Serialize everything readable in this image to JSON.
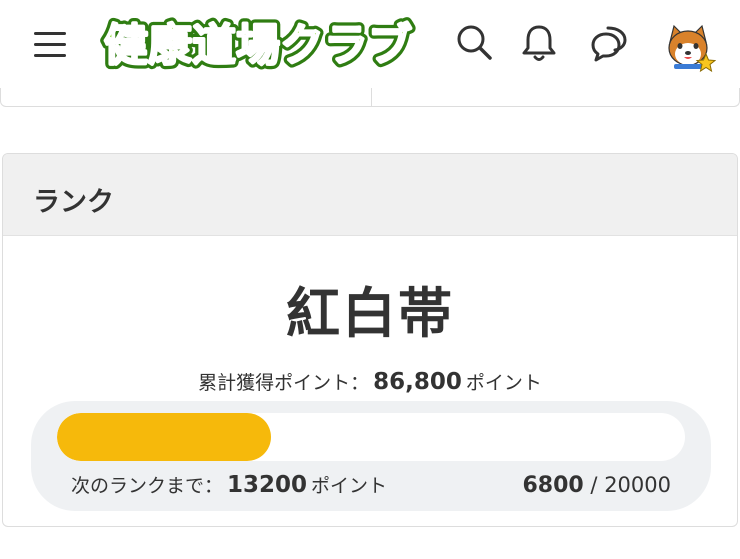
{
  "header": {
    "logo_text": "健康道場クラブ",
    "menu_icon": "hamburger-menu-icon",
    "search_icon": "search-icon",
    "notification_icon": "bell-icon",
    "chat_icon": "chat-bubbles-icon",
    "avatar_icon": "shiba-dog-avatar-with-star"
  },
  "rank_card": {
    "title": "ランク",
    "rank_name": "紅白帯",
    "total_points_label": "累計獲得ポイント：",
    "total_points_value": "86,800",
    "total_points_unit": "ポイント",
    "next_rank_label": "次のランクまで：",
    "next_rank_value": "13200",
    "next_rank_unit": "ポイント",
    "progress_current": "6800",
    "progress_separator": "/",
    "progress_max": "20000",
    "progress_fraction": 0.34
  },
  "colors": {
    "logo_green": "#5cc22a",
    "logo_outline": "#2f7d12",
    "progress_fill": "#f6b90b",
    "progress_panel": "#eff1f3",
    "card_header_bg": "#f0f0f0"
  }
}
